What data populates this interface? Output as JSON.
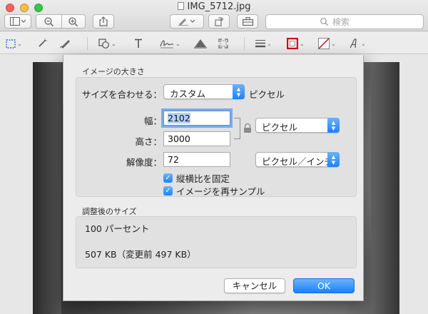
{
  "window": {
    "title": "IMG_5712.jpg",
    "search_placeholder": "検索"
  },
  "toolbar": {
    "left_icons": [
      "sidebar-toggle-icon",
      "zoom-out-icon",
      "zoom-in-icon",
      "share-icon"
    ],
    "right_icons": [
      "markup-pen-icon",
      "rotate-icon",
      "toolbox-icon"
    ]
  },
  "markup_tools": [
    "rect-selection-icon",
    "instant-alpha-icon",
    "sketch-icon",
    "shapes-icon",
    "text-icon",
    "signature-icon",
    "adjust-color-icon",
    "adjust-size-icon",
    "line-style-icon",
    "border-color-icon",
    "fill-color-icon",
    "text-style-icon"
  ],
  "colors": {
    "accent": "#1a82fb",
    "border_color_swatch": "#d0021b",
    "focus_ring": "#7aaaf0"
  },
  "dialog": {
    "section_title": "イメージの大きさ",
    "fit_label": "サイズを合わせる：",
    "fit_value": "カスタム",
    "fit_unit": "ピクセル",
    "width_label": "幅：",
    "width_value": "2102",
    "height_label": "高さ：",
    "height_value": "3000",
    "size_unit": "ピクセル",
    "resolution_label": "解像度：",
    "resolution_value": "72",
    "resolution_unit": "ピクセル／インチ",
    "checkbox_proportional": "縦横比を固定",
    "checkbox_resample": "イメージを再サンプル",
    "result_title": "調整後のサイズ",
    "result_percent": "100 パーセント",
    "result_size": "507 KB（変更前 497 KB）",
    "cancel_button": "キャンセル",
    "ok_button": "OK"
  }
}
